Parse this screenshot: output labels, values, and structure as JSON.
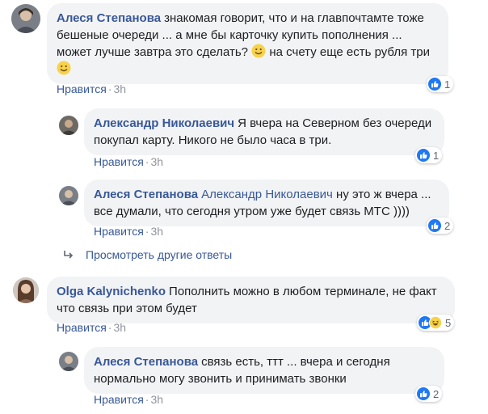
{
  "comments": [
    {
      "author": "Алеся Степанова",
      "text_part1": "знакомая говорит, что и на главпочтамте тоже бешеные очереди ... а мне бы карточку купить пополнения ... может лучше завтра это сделать?",
      "text_part2": "на счету еще есть рубля три",
      "emoji1": "smile-emoji",
      "emoji2": "smile-emoji",
      "like_label": "Нравится",
      "time": "3h",
      "reaction_count": "1"
    },
    {
      "author": "Александр Николаевич",
      "text": "Я вчера на Северном без очереди покупал карту. Никого не было часа в три.",
      "like_label": "Нравится",
      "time": "3h",
      "reaction_count": "1"
    },
    {
      "author": "Алеся Степанова",
      "mention": "Александр Николаевич",
      "text": "ну это ж вчера ... все думали, что сегодня утром уже будет связь МТС ))))",
      "like_label": "Нравится",
      "time": "3h",
      "reaction_count": "2"
    },
    {
      "author": "Olga Kalynichenko",
      "text": "Пополнить можно в любом терминале, не факт что связь при этом будет",
      "like_label": "Нравится",
      "time": "3h",
      "reaction_count": "5"
    },
    {
      "author": "Алеся Степанова",
      "text": "связь есть, ттт ... вчера и сегодня нормально могу звонить и принимать звонки",
      "like_label": "Нравится",
      "time": "3h",
      "reaction_count": "2"
    }
  ],
  "more_replies_label": "Просмотреть другие ответы",
  "colors": {
    "link": "#385898",
    "bubble": "#f2f3f5",
    "meta": "#90949c",
    "like_blue": "#2078f4"
  }
}
